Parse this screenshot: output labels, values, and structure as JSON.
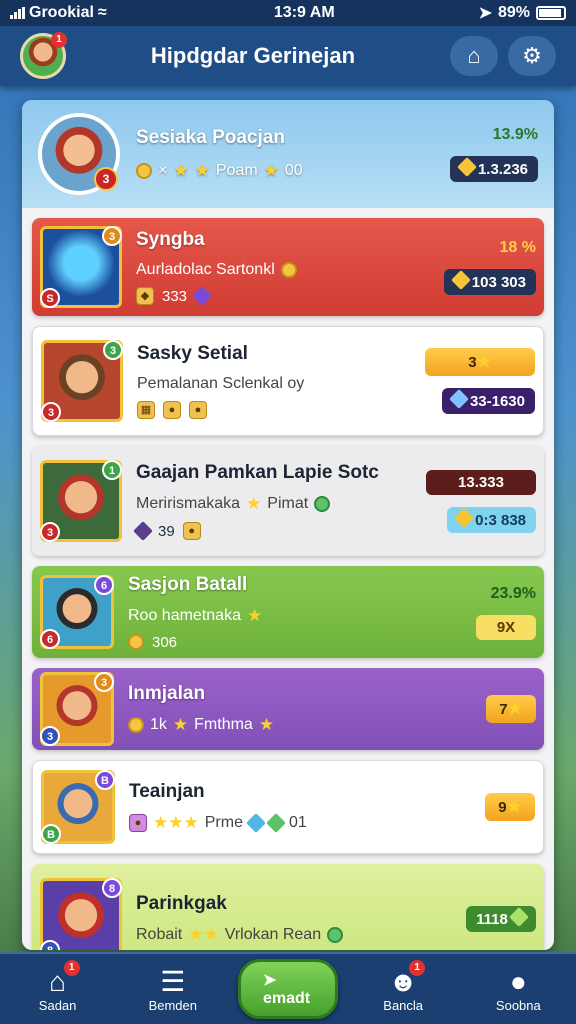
{
  "status": {
    "carrier": "Grookial",
    "time": "13:9 AM",
    "battery": "89%"
  },
  "header": {
    "title": "Hipdgdar Gerinejan",
    "avatar_badge": "1",
    "home_icon": "home-icon",
    "settings_icon": "gear-icon"
  },
  "me": {
    "name": "Sesiaka Poacjan",
    "level_badge": "3",
    "sub_text": "Poam",
    "sub_value": "00",
    "percent": "13.9%",
    "coins": "1.3.236"
  },
  "rows": [
    {
      "name": "Syngba",
      "sub": "Aurladolac Sartonkl",
      "sub2": "333",
      "percent": "18 %",
      "value": "103 303",
      "badge_left": "S",
      "badge_right": "3",
      "color": "#e6584b"
    },
    {
      "name": "Sasky Setial",
      "sub": "Pemalanan Sclenkal oy",
      "value_top": "3",
      "value": "33-1630",
      "badge_left": "3",
      "badge_right": "3",
      "color": "#ffffff"
    },
    {
      "name": "Gaajan Pamkan Lapie Sotc",
      "sub": "Merirismakaka",
      "sub_b": "Pimat",
      "sub2": "39",
      "value_top": "13.333",
      "value": "0:3 838",
      "badge_left": "3",
      "badge_right": "1",
      "color": "#ececee"
    },
    {
      "name": "Sasjon Batall",
      "sub": "Roo hametnaka",
      "sub2": "306",
      "percent": "23.9%",
      "value": "9X",
      "badge_left": "6",
      "badge_right": "6",
      "color": "#86c84f"
    },
    {
      "name": "Inmjalan",
      "sub": "1k",
      "sub_b": "Fmthma",
      "value": "7",
      "badge_left": "3",
      "badge_right": "3",
      "color": "#9a62c9"
    },
    {
      "name": "Teainjan",
      "sub": "Prme",
      "sub_b": "01",
      "value": "9",
      "badge_left": "B",
      "badge_right": "B",
      "color": "#ffffff"
    },
    {
      "name": "Parinkgak",
      "sub": "Robait",
      "sub_b": "Vrlokan Rean",
      "value": "1118",
      "badge_left": "8",
      "badge_right": "8",
      "color": "#dff09d"
    }
  ],
  "nav": {
    "items": [
      {
        "label": "Sadan",
        "icon": "home-icon",
        "badge": "1"
      },
      {
        "label": "Bemden",
        "icon": "list-icon"
      },
      {
        "label": "emadt",
        "icon": "play-icon"
      },
      {
        "label": "Bancla",
        "icon": "profile-icon",
        "badge": "1"
      },
      {
        "label": "Soobna",
        "icon": "user-icon"
      }
    ]
  }
}
